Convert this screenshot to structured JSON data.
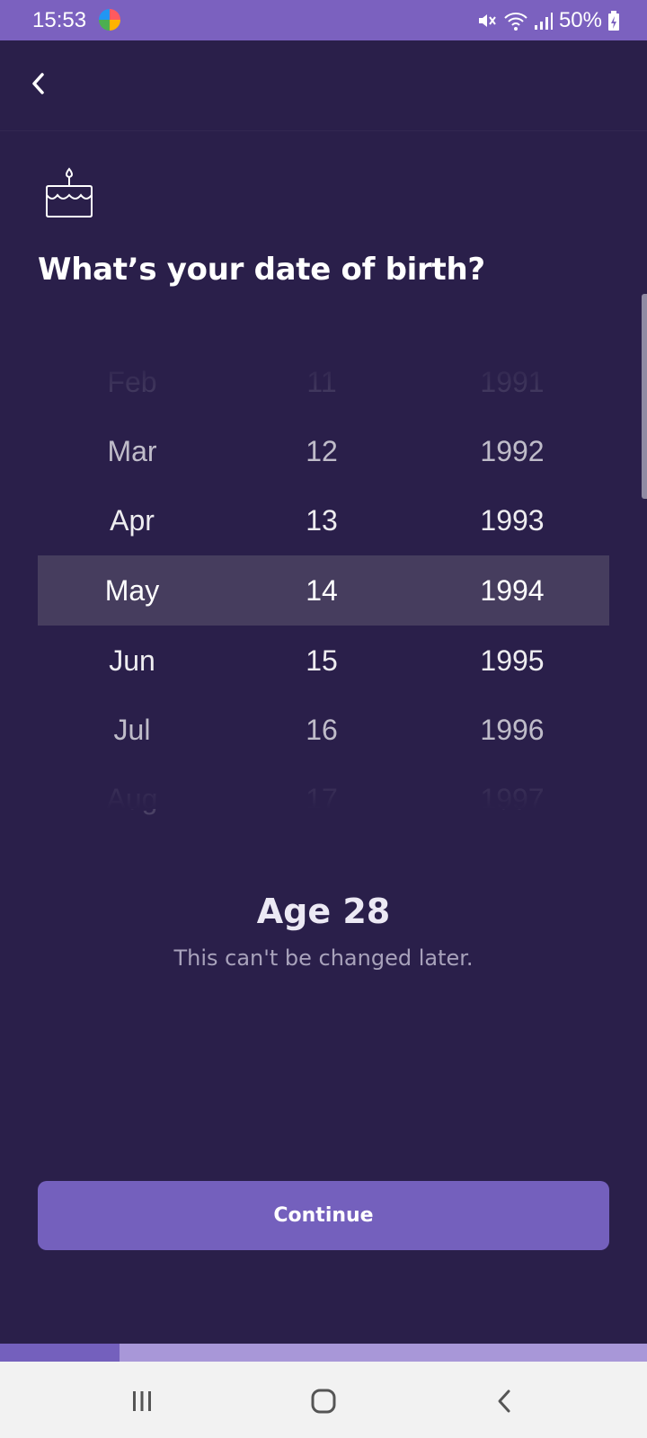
{
  "status_bar": {
    "time": "15:53",
    "battery": "50%",
    "icons": [
      "app-notification-icon",
      "mute-icon",
      "wifi-icon",
      "signal-icon",
      "battery-charging-icon"
    ]
  },
  "header": {
    "back_icon": "chevron-left-icon"
  },
  "page": {
    "icon": "birthday-cake-icon",
    "title": "What’s your date of birth?"
  },
  "picker": {
    "months": [
      "Feb",
      "Mar",
      "Apr",
      "May",
      "Jun",
      "Jul",
      "Aug"
    ],
    "days": [
      "11",
      "12",
      "13",
      "14",
      "15",
      "16",
      "17"
    ],
    "years": [
      "1991",
      "1992",
      "1993",
      "1994",
      "1995",
      "1996",
      "1997"
    ],
    "selected": {
      "month": "May",
      "day": "14",
      "year": "1994"
    }
  },
  "age": {
    "label": "Age 28",
    "note": "This can't be changed later."
  },
  "continue_label": "Continue",
  "progress": {
    "fraction": 0.185
  },
  "colors": {
    "background": "#2a1f4a",
    "accent": "#7460bd",
    "status_bar": "#7b61bf",
    "highlight": "#463d5e"
  },
  "nav_bar": {
    "icons": [
      "recents-icon",
      "home-icon",
      "back-icon"
    ]
  }
}
